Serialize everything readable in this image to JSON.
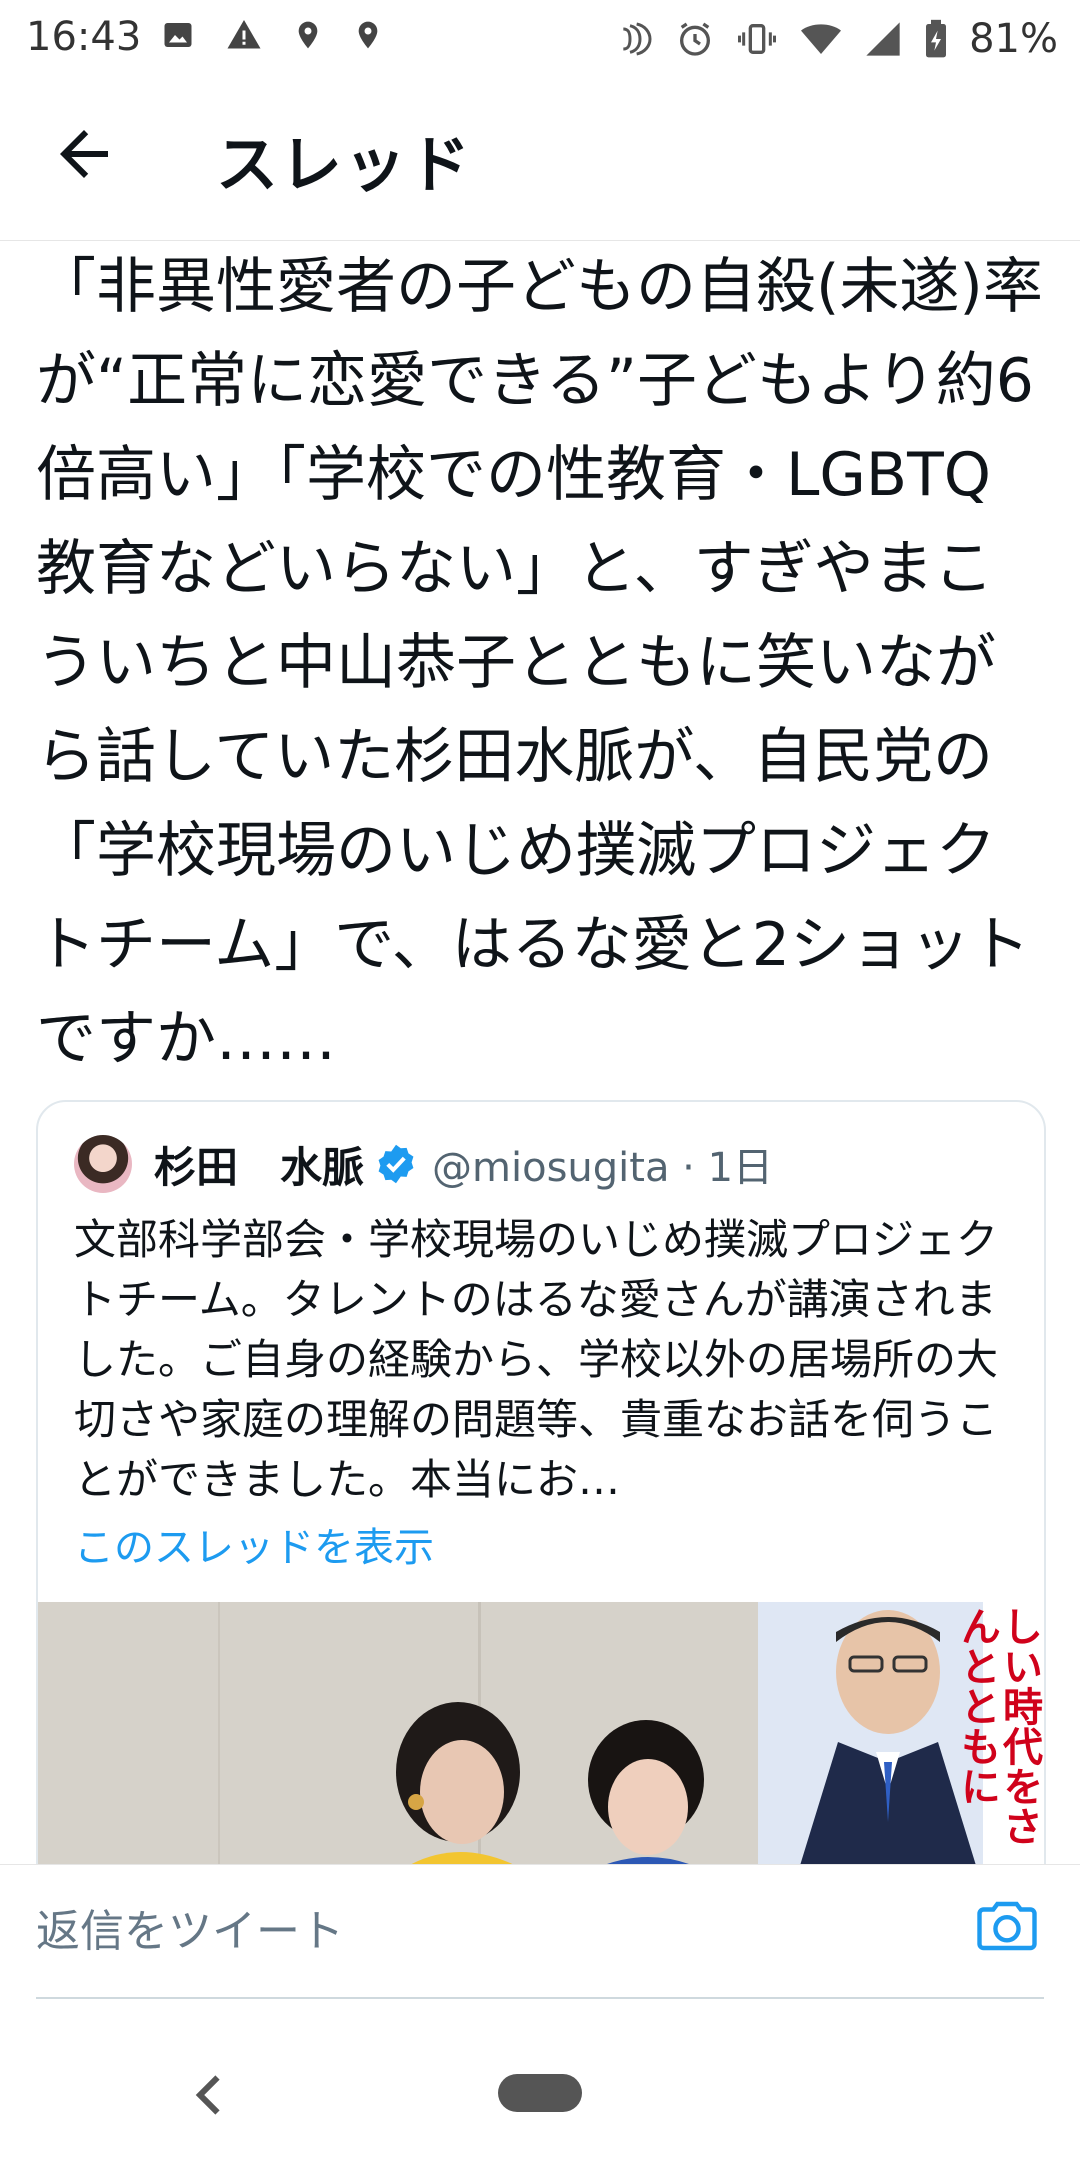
{
  "status_bar": {
    "time": "16:43",
    "battery": "81%",
    "left_icons": [
      "image-icon",
      "alert-icon",
      "location-icon",
      "location-icon"
    ],
    "right_icons": [
      "nfc-icon",
      "alarm-icon",
      "vibrate-icon",
      "wifi-icon",
      "signal-icon",
      "battery-icon"
    ]
  },
  "header": {
    "title": "スレッド"
  },
  "tweet": {
    "text": "「非異性愛者の子どもの自殺(未遂)率が“正常に恋愛できる”子どもより約6倍高い」「学校での性教育・LGBTQ教育などいらない」と、すぎやまこういちと中山恭子とともに笑いながら話していた杉田水脈が、自民党の「学校現場のいじめ撲滅プロジェクトチーム」で、はるな愛と2ショットですか……"
  },
  "quote": {
    "name": "杉田　水脈",
    "handle": "@miosugita · 1日",
    "text": "文部科学部会・学校現場のいじめ撲滅プロジェクトチーム。タレントのはるな愛さんが講演されました。ご自身の経験から、学校以外の居場所の大切さや家庭の理解の問題等、貴重なお話を伺うことができました。本当にお…",
    "show_thread": "このスレッドを表示",
    "poster_text": "しい時代をさんとともに"
  },
  "reply": {
    "placeholder": "返信をツイート"
  },
  "colors": {
    "accent": "#1d9bf0",
    "text": "#0f1419",
    "muted": "#536471"
  }
}
